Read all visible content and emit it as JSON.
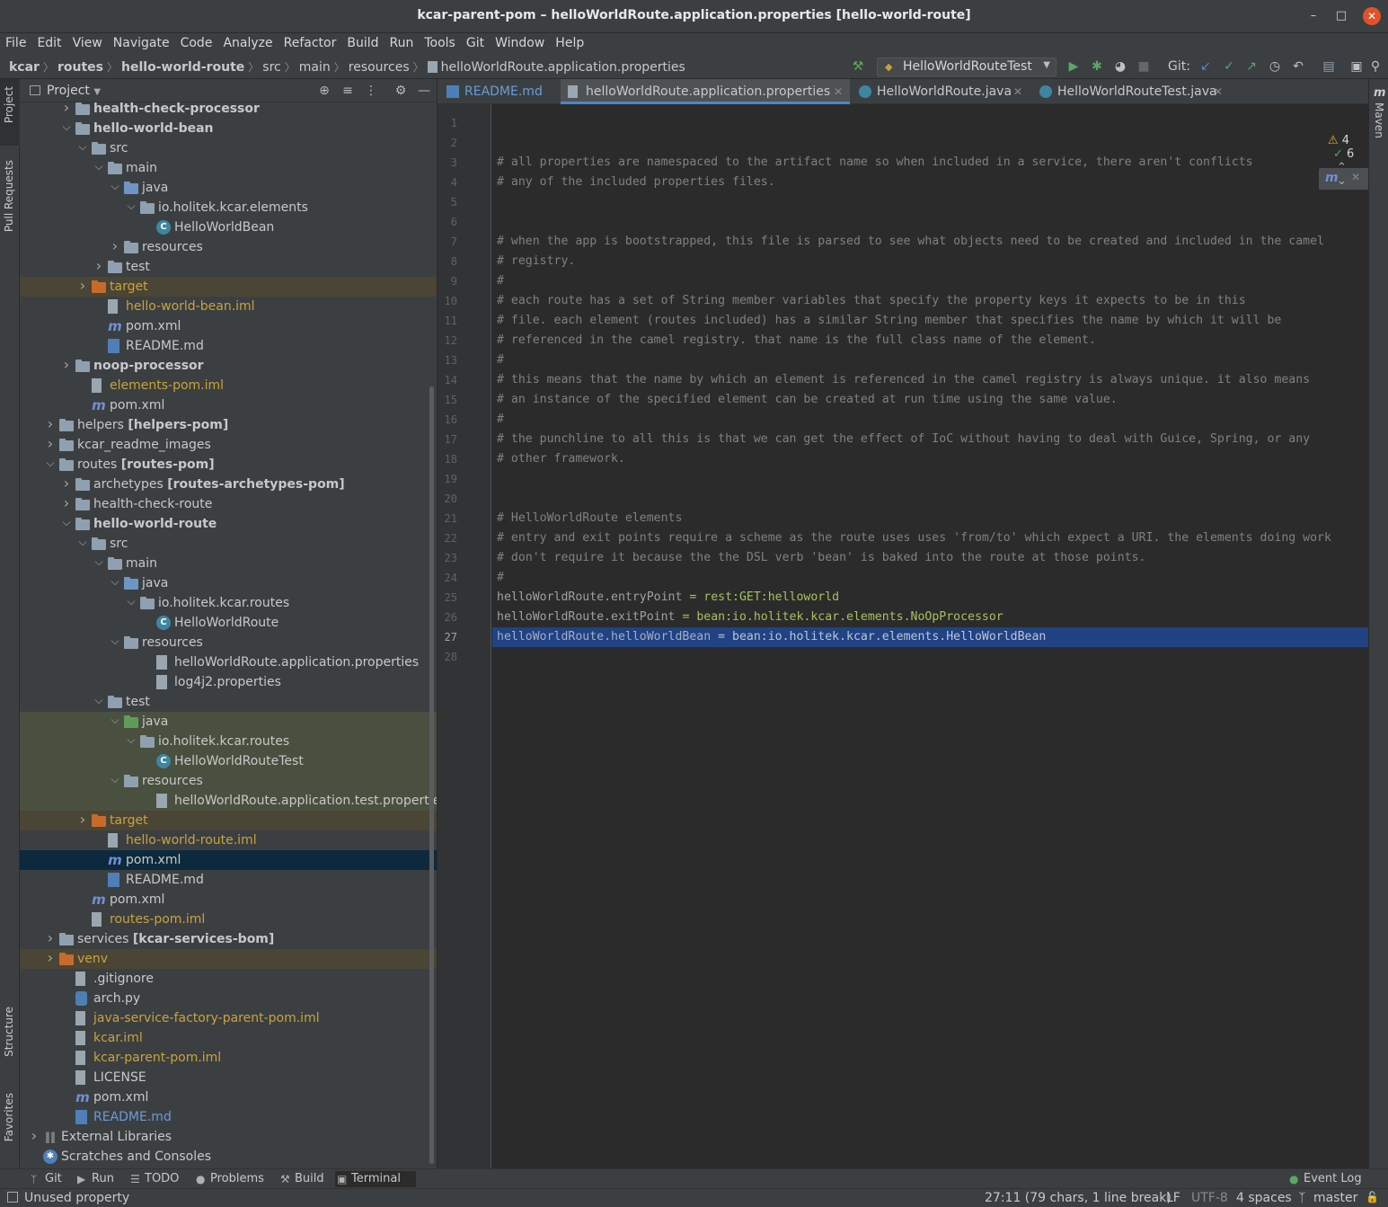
{
  "window": {
    "title": "kcar-parent-pom – helloWorldRoute.application.properties [hello-world-route]"
  },
  "menu": [
    "File",
    "Edit",
    "View",
    "Navigate",
    "Code",
    "Analyze",
    "Refactor",
    "Build",
    "Run",
    "Tools",
    "Git",
    "Window",
    "Help"
  ],
  "breadcrumbs": [
    "kcar",
    "routes",
    "hello-world-route",
    "src",
    "main",
    "resources",
    "helloWorldRoute.application.properties"
  ],
  "run_config": "HelloWorldRouteTest",
  "git_label": "Git:",
  "left_tabs": {
    "project": "Project",
    "pull_requests": "Pull Requests",
    "structure": "Structure",
    "favorites": "Favorites"
  },
  "right_tabs": {
    "maven": "Maven"
  },
  "project_panel": {
    "title": "Project"
  },
  "tree": [
    {
      "label": "health-check-processor",
      "depth": 2,
      "expand": "closed",
      "icon": "folder-module",
      "bold": true
    },
    {
      "label": "hello-world-bean",
      "depth": 2,
      "expand": "open",
      "icon": "folder-module",
      "bold": true
    },
    {
      "label": "src",
      "depth": 3,
      "expand": "open",
      "icon": "folder"
    },
    {
      "label": "main",
      "depth": 4,
      "expand": "open",
      "icon": "folder"
    },
    {
      "label": "java",
      "depth": 5,
      "expand": "open",
      "icon": "folder-src"
    },
    {
      "label": "io.holitek.kcar.elements",
      "depth": 6,
      "expand": "open",
      "icon": "package"
    },
    {
      "label": "HelloWorldBean",
      "depth": 7,
      "expand": "none",
      "icon": "class"
    },
    {
      "label": "resources",
      "depth": 5,
      "expand": "closed",
      "icon": "folder-res"
    },
    {
      "label": "test",
      "depth": 4,
      "expand": "closed",
      "icon": "folder"
    },
    {
      "label": "target",
      "depth": 3,
      "expand": "closed",
      "icon": "folder-excl",
      "style": "excluded",
      "color": "orange"
    },
    {
      "label": "hello-world-bean.iml",
      "depth": 4,
      "expand": "none",
      "icon": "file",
      "color": "orange"
    },
    {
      "label": "pom.xml",
      "depth": 4,
      "expand": "none",
      "icon": "maven"
    },
    {
      "label": "README.md",
      "depth": 4,
      "expand": "none",
      "icon": "md"
    },
    {
      "label": "noop-processor",
      "depth": 2,
      "expand": "closed",
      "icon": "folder-module",
      "bold": true
    },
    {
      "label": "elements-pom.iml",
      "depth": 3,
      "expand": "none",
      "icon": "file",
      "color": "orange"
    },
    {
      "label": "pom.xml",
      "depth": 3,
      "expand": "none",
      "icon": "maven"
    },
    {
      "label": "helpers",
      "module": "[helpers-pom]",
      "depth": 1,
      "expand": "closed",
      "icon": "folder-module"
    },
    {
      "label": "kcar_readme_images",
      "depth": 1,
      "expand": "closed",
      "icon": "folder"
    },
    {
      "label": "routes",
      "module": "[routes-pom]",
      "depth": 1,
      "expand": "open",
      "icon": "folder-module"
    },
    {
      "label": "archetypes",
      "module": "[routes-archetypes-pom]",
      "depth": 2,
      "expand": "closed",
      "icon": "folder-module"
    },
    {
      "label": "health-check-route",
      "depth": 2,
      "expand": "closed",
      "icon": "folder-module"
    },
    {
      "label": "hello-world-route",
      "depth": 2,
      "expand": "open",
      "icon": "folder-module",
      "bold": true
    },
    {
      "label": "src",
      "depth": 3,
      "expand": "open",
      "icon": "folder"
    },
    {
      "label": "main",
      "depth": 4,
      "expand": "open",
      "icon": "folder"
    },
    {
      "label": "java",
      "depth": 5,
      "expand": "open",
      "icon": "folder-src"
    },
    {
      "label": "io.holitek.kcar.routes",
      "depth": 6,
      "expand": "open",
      "icon": "package"
    },
    {
      "label": "HelloWorldRoute",
      "depth": 7,
      "expand": "none",
      "icon": "class"
    },
    {
      "label": "resources",
      "depth": 5,
      "expand": "open",
      "icon": "folder-res"
    },
    {
      "label": "helloWorldRoute.application.properties",
      "depth": 7,
      "expand": "none",
      "icon": "props"
    },
    {
      "label": "log4j2.properties",
      "depth": 7,
      "expand": "none",
      "icon": "props"
    },
    {
      "label": "test",
      "depth": 4,
      "expand": "open",
      "icon": "folder"
    },
    {
      "label": "java",
      "depth": 5,
      "expand": "open",
      "icon": "folder-test",
      "style": "testsrc"
    },
    {
      "label": "io.holitek.kcar.routes",
      "depth": 6,
      "expand": "open",
      "icon": "package",
      "style": "testsrc"
    },
    {
      "label": "HelloWorldRouteTest",
      "depth": 7,
      "expand": "none",
      "icon": "class",
      "style": "testsrc"
    },
    {
      "label": "resources",
      "depth": 5,
      "expand": "open",
      "icon": "folder-res",
      "style": "testsrc"
    },
    {
      "label": "helloWorldRoute.application.test.propertie",
      "depth": 7,
      "expand": "none",
      "icon": "props",
      "style": "testsrc"
    },
    {
      "label": "target",
      "depth": 3,
      "expand": "closed",
      "icon": "folder-excl",
      "style": "excluded",
      "color": "orange"
    },
    {
      "label": "hello-world-route.iml",
      "depth": 4,
      "expand": "none",
      "icon": "file",
      "color": "orange"
    },
    {
      "label": "pom.xml",
      "depth": 4,
      "expand": "none",
      "icon": "maven",
      "style": "selected"
    },
    {
      "label": "README.md",
      "depth": 4,
      "expand": "none",
      "icon": "md"
    },
    {
      "label": "pom.xml",
      "depth": 3,
      "expand": "none",
      "icon": "maven"
    },
    {
      "label": "routes-pom.iml",
      "depth": 3,
      "expand": "none",
      "icon": "file",
      "color": "orange"
    },
    {
      "label": "services",
      "module": "[kcar-services-bom]",
      "depth": 1,
      "expand": "closed",
      "icon": "folder-module"
    },
    {
      "label": "venv",
      "depth": 1,
      "expand": "closed",
      "icon": "folder-excl",
      "style": "excluded",
      "color": "orange"
    },
    {
      "label": ".gitignore",
      "depth": 2,
      "expand": "none",
      "icon": "file"
    },
    {
      "label": "arch.py",
      "depth": 2,
      "expand": "none",
      "icon": "py"
    },
    {
      "label": "java-service-factory-parent-pom.iml",
      "depth": 2,
      "expand": "none",
      "icon": "file",
      "color": "orange"
    },
    {
      "label": "kcar.iml",
      "depth": 2,
      "expand": "none",
      "icon": "file",
      "color": "orange"
    },
    {
      "label": "kcar-parent-pom.iml",
      "depth": 2,
      "expand": "none",
      "icon": "file",
      "color": "orange"
    },
    {
      "label": "LICENSE",
      "depth": 2,
      "expand": "none",
      "icon": "file"
    },
    {
      "label": "pom.xml",
      "depth": 2,
      "expand": "none",
      "icon": "maven"
    },
    {
      "label": "README.md",
      "depth": 2,
      "expand": "none",
      "icon": "md",
      "color": "blue"
    },
    {
      "label": "External Libraries",
      "depth": 0,
      "expand": "closed",
      "icon": "libs"
    },
    {
      "label": "Scratches and Consoles",
      "depth": 0,
      "expand": "none",
      "icon": "scratch"
    }
  ],
  "tabs": [
    {
      "label": "README.md",
      "kind": "md"
    },
    {
      "label": "helloWorldRoute.application.properties",
      "kind": "props",
      "active": true
    },
    {
      "label": "HelloWorldRoute.java",
      "kind": "class"
    },
    {
      "label": "HelloWorldRouteTest.java",
      "kind": "class"
    }
  ],
  "inspection": {
    "warnings": "4",
    "ok": "6"
  },
  "current_line": 27,
  "code_lines": [
    "",
    "",
    "# all properties are namespaced to the artifact name so when included in a service, there aren't conflicts",
    "# any of the included properties files.",
    "",
    "",
    "# when the app is bootstrapped, this file is parsed to see what objects need to be created and included in the camel",
    "# registry.",
    "#",
    "# each route has a set of String member variables that specify the property keys it expects to be in this",
    "# file. each element (routes included) has a similar String member that specifies the name by which it will be",
    "# referenced in the camel registry. that name is the full class name of the element.",
    "#",
    "# this means that the name by which an element is referenced in the camel registry is always unique. it also means",
    "# an instance of the specified element can be created at run time using the same value.",
    "#",
    "# the punchline to all this is that we can get the effect of IoC without having to deal with Guice, Spring, or any",
    "# other framework.",
    "",
    "",
    "# HelloWorldRoute elements",
    "# entry and exit points require a scheme as the route uses uses 'from/to' which expect a URI. the elements doing work",
    "# don't require it because the the DSL verb 'bean' is baked into the route at those points.",
    "#",
    "helloWorldRoute.entryPoint = rest:GET:helloworld",
    "helloWorldRoute.exitPoint = bean:io.holitek.kcar.elements.NoOpProcessor",
    "helloWorldRoute.helloWorldBean = bean:io.holitek.kcar.elements.HelloWorldBean",
    ""
  ],
  "toolwindows": [
    {
      "label": "Git",
      "icon": "git-icon"
    },
    {
      "label": "Run",
      "icon": "run-icon"
    },
    {
      "label": "TODO",
      "icon": "todo-icon"
    },
    {
      "label": "Problems",
      "icon": "problems-icon"
    },
    {
      "label": "Build",
      "icon": "build-icon"
    },
    {
      "label": "Terminal",
      "icon": "terminal-icon",
      "active": true
    }
  ],
  "event_log": "Event Log",
  "status": {
    "message": "Unused property",
    "position": "27:11 (79 chars, 1 line break)",
    "line_sep": "LF",
    "encoding": "UTF-8",
    "indent": "4 spaces",
    "branch": "master"
  },
  "colors": {
    "accent": "#4a88c7",
    "selection": "#214283",
    "excluded_bg": "#4b4535",
    "test_bg": "#49503f",
    "tree_selected": "#0d293e"
  }
}
